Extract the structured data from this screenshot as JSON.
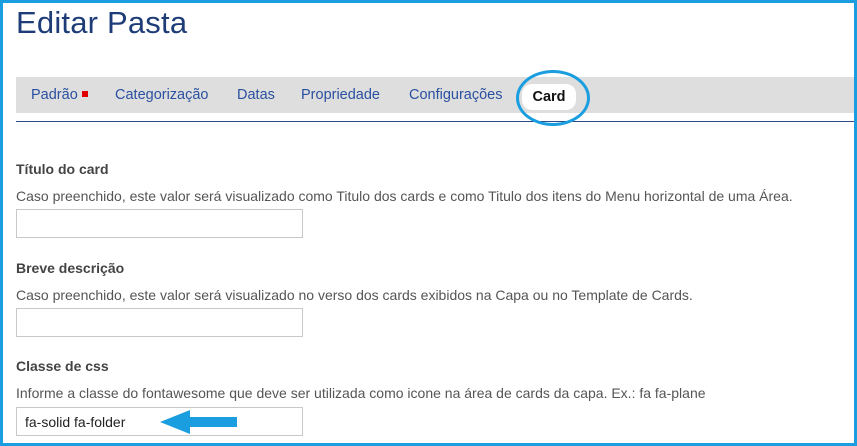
{
  "page": {
    "title": "Editar Pasta"
  },
  "tabs": [
    {
      "label": "Padrão",
      "required": true
    },
    {
      "label": "Categorização"
    },
    {
      "label": "Datas"
    },
    {
      "label": "Propriedade"
    },
    {
      "label": "Configurações"
    },
    {
      "label": "Card",
      "active": true
    }
  ],
  "fields": [
    {
      "label": "Título do card",
      "help": "Caso preenchido, este valor será visualizado como Titulo dos cards e como Titulo dos itens do Menu horizontal de uma Área.",
      "value": ""
    },
    {
      "label": "Breve descrição",
      "help": "Caso preenchido, este valor será visualizado no verso dos cards exibidos na Capa ou no Template de Cards.",
      "value": ""
    },
    {
      "label": "Classe de css",
      "help": "Informe a classe do fontawesome que deve ser utilizada como icone na área de cards da capa. Ex.: fa fa-plane",
      "value": "fa-solid fa-folder"
    }
  ],
  "colors": {
    "highlight": "#1a9ee0",
    "title": "#1e3c78",
    "tab_text": "#2a50a0",
    "required_marker": "#e00000"
  },
  "annotation": {
    "arrow_icon": "left-arrow-icon",
    "circle": "highlight-circle"
  }
}
